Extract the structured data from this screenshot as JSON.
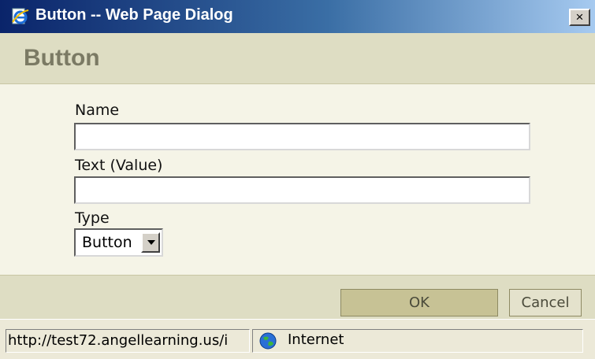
{
  "window": {
    "title": "Button -- Web Page Dialog",
    "close_glyph": "×"
  },
  "header": {
    "title": "Button"
  },
  "form": {
    "name_label": "Name",
    "name_value": "",
    "text_label": "Text (Value)",
    "text_value": "",
    "type_label": "Type",
    "type_selected": "Button"
  },
  "footer": {
    "ok_label": "OK",
    "cancel_label": "Cancel"
  },
  "statusbar": {
    "url": "http://test72.angellearning.us/i",
    "zone": "Internet"
  },
  "icons": {
    "title_icon": "ie-page-icon",
    "zone_icon": "globe-icon"
  },
  "colors": {
    "titlebar_start": "#0a246a",
    "band": "#deddc3",
    "form_bg": "#f5f4e7",
    "ok_button": "#c7c295",
    "heading": "#7b7a64"
  }
}
